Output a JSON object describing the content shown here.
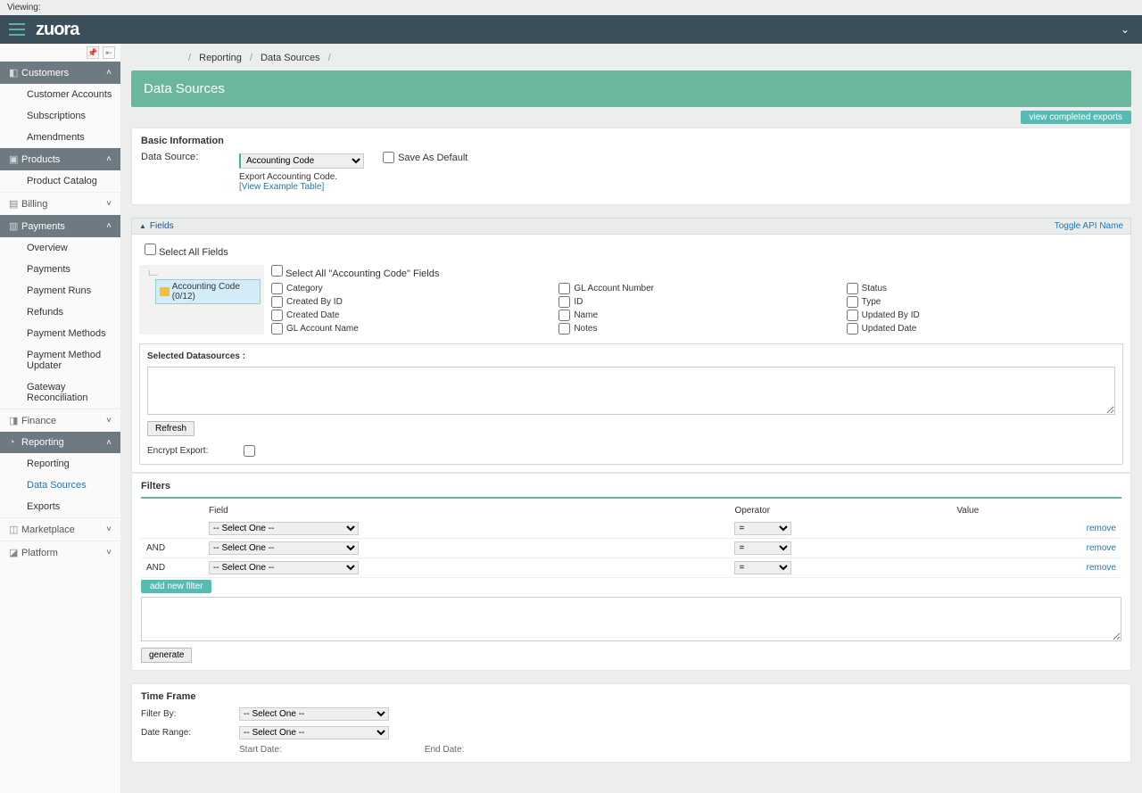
{
  "viewing_label": "Viewing:",
  "logo": "zuora",
  "breadcrumb": {
    "item1": "Reporting",
    "item2": "Data Sources"
  },
  "page_title": "Data Sources",
  "view_exports_btn": "view completed exports",
  "sidebar": {
    "customers": {
      "label": "Customers",
      "items": [
        "Customer Accounts",
        "Subscriptions",
        "Amendments"
      ]
    },
    "products": {
      "label": "Products",
      "items": [
        "Product Catalog"
      ]
    },
    "billing": {
      "label": "Billing"
    },
    "payments": {
      "label": "Payments",
      "items": [
        "Overview",
        "Payments",
        "Payment Runs",
        "Refunds",
        "Payment Methods",
        "Payment Method Updater",
        "Gateway Reconciliation"
      ]
    },
    "finance": {
      "label": "Finance"
    },
    "reporting": {
      "label": "Reporting",
      "items": [
        "Reporting",
        "Data Sources",
        "Exports"
      ]
    },
    "marketplace": {
      "label": "Marketplace"
    },
    "platform": {
      "label": "Platform"
    }
  },
  "basic": {
    "title": "Basic Information",
    "ds_label": "Data Source:",
    "ds_value": "Accounting Code",
    "helper1": "Export Accounting Code.",
    "helper2": "[View Example Table]",
    "save_default": "Save As Default"
  },
  "fields": {
    "bar_label": "Fields",
    "toggle_api": "Toggle API Name",
    "select_all": "Select All Fields",
    "node_label": "Accounting Code (0/12)",
    "select_all_ac": "Select All \"Accounting Code\" Fields",
    "list": [
      "Category",
      "Created By ID",
      "Created Date",
      "GL Account Name",
      "GL Account Number",
      "ID",
      "Name",
      "Notes",
      "Status",
      "Type",
      "Updated By ID",
      "Updated Date"
    ],
    "selected_label": "Selected Datasources :",
    "refresh": "Refresh",
    "encrypt_label": "Encrypt Export:"
  },
  "filters": {
    "title": "Filters",
    "col_field": "Field",
    "col_op": "Operator",
    "col_val": "Value",
    "and": "AND",
    "select_one": "-- Select One --",
    "eq": "=",
    "remove": "remove",
    "add": "add new filter",
    "generate": "generate"
  },
  "timeframe": {
    "title": "Time Frame",
    "filter_by": "Filter By:",
    "date_range": "Date Range:",
    "select_one": "-- Select One --",
    "start": "Start Date:",
    "end": "End Date:"
  }
}
